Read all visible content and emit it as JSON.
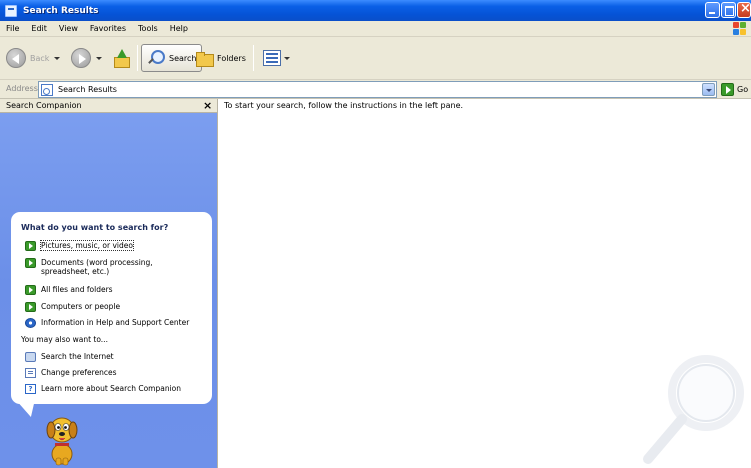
{
  "window": {
    "title": "Search Results"
  },
  "menu": {
    "items": [
      "File",
      "Edit",
      "View",
      "Favorites",
      "Tools",
      "Help"
    ]
  },
  "toolbar": {
    "back_label": "Back",
    "search_label": "Search",
    "folders_label": "Folders"
  },
  "address": {
    "label": "Address",
    "value": "Search Results",
    "go_label": "Go"
  },
  "pane": {
    "title": "Search Companion",
    "close_glyph": "×",
    "question": "What do you want to search for?",
    "options": [
      {
        "label": "Pictures, music, or video",
        "icon": "green-arrow-icon"
      },
      {
        "label": "Documents (word processing,\nspreadsheet, etc.)",
        "icon": "green-arrow-icon"
      },
      {
        "label": "All files and folders",
        "icon": "green-arrow-icon"
      },
      {
        "label": "Computers or people",
        "icon": "green-arrow-icon"
      },
      {
        "label": "Information in Help and Support Center",
        "icon": "help-center-icon"
      }
    ],
    "also_heading": "You may also want to...",
    "also_options": [
      {
        "label": "Search the Internet",
        "icon": "internet-search-icon"
      },
      {
        "label": "Change preferences",
        "icon": "preferences-icon"
      },
      {
        "label": "Learn more about Search Companion",
        "icon": "question-mark-icon"
      }
    ]
  },
  "content": {
    "instruction": "To start your search, follow the instructions in the left pane."
  },
  "colors": {
    "titlebar": "#0553d6",
    "pane_blue": "#6b8fe8",
    "chrome": "#ece9d8",
    "go_green": "#3a9a2a"
  }
}
